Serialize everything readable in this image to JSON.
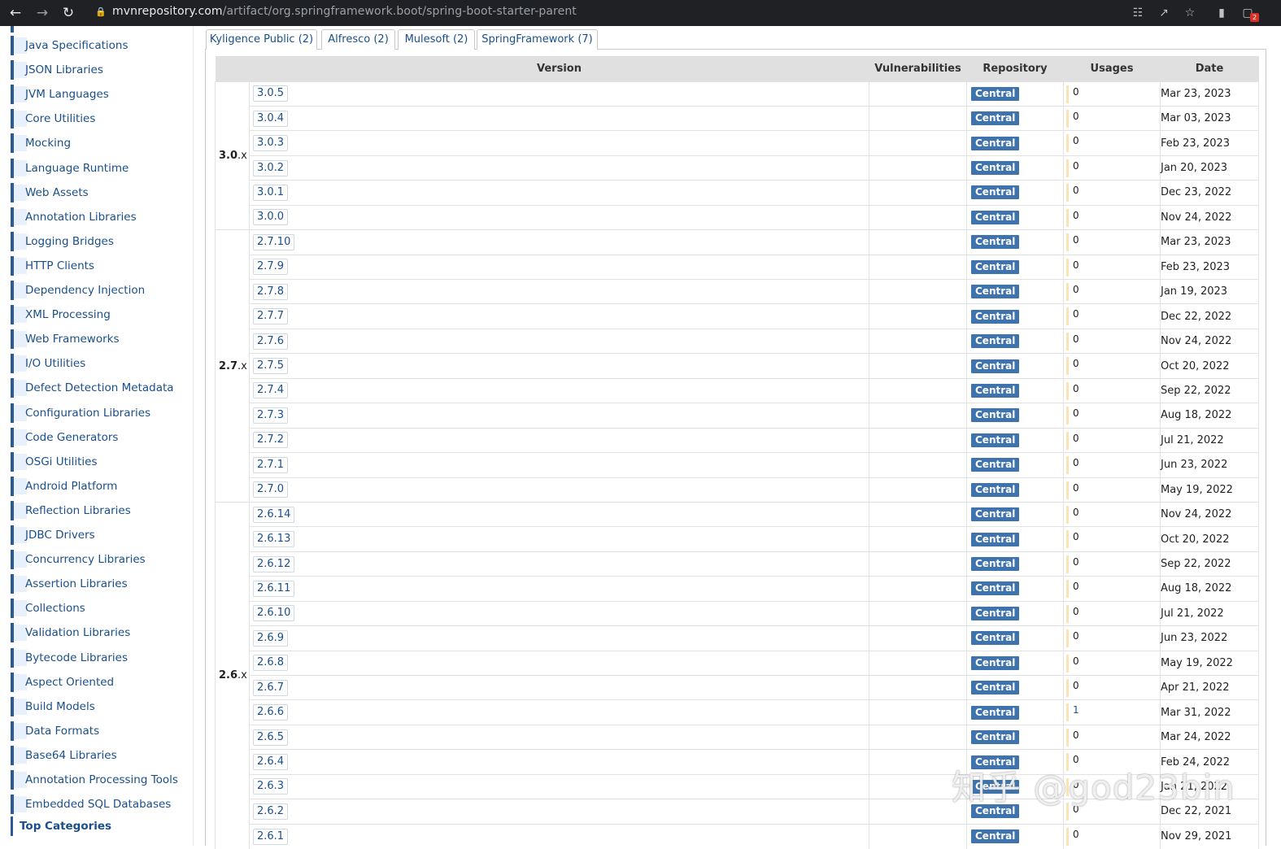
{
  "browser": {
    "url_host": "mvnrepository.com",
    "url_path": "/artifact/org.springframework.boot/spring-boot-starter-parent",
    "extension_badge": "2"
  },
  "sidebar": {
    "items": [
      "Java Specifications",
      "JSON Libraries",
      "JVM Languages",
      "Core Utilities",
      "Mocking",
      "Language Runtime",
      "Web Assets",
      "Annotation Libraries",
      "Logging Bridges",
      "HTTP Clients",
      "Dependency Injection",
      "XML Processing",
      "Web Frameworks",
      "I/O Utilities",
      "Defect Detection Metadata",
      "Configuration Libraries",
      "Code Generators",
      "OSGi Utilities",
      "Android Platform",
      "Reflection Libraries",
      "JDBC Drivers",
      "Concurrency Libraries",
      "Assertion Libraries",
      "Collections",
      "Validation Libraries",
      "Bytecode Libraries",
      "Aspect Oriented",
      "Build Models",
      "Data Formats",
      "Base64 Libraries",
      "Annotation Processing Tools",
      "Embedded SQL Databases"
    ],
    "top_categories_label": "Top Categories"
  },
  "tabs": [
    "Kyligence Public (2)",
    "Alfresco (2)",
    "Mulesoft (2)",
    "SpringFramework (7)"
  ],
  "table": {
    "headers": {
      "version": "Version",
      "vulnerabilities": "Vulnerabilities",
      "repository": "Repository",
      "usages": "Usages",
      "date": "Date"
    },
    "groups": [
      {
        "major": "3.0",
        "suffix": ".x",
        "rows": [
          {
            "v": "3.0.5",
            "repo": "Central",
            "usages": "0",
            "date": "Mar 23, 2023"
          },
          {
            "v": "3.0.4",
            "repo": "Central",
            "usages": "0",
            "date": "Mar 03, 2023"
          },
          {
            "v": "3.0.3",
            "repo": "Central",
            "usages": "0",
            "date": "Feb 23, 2023"
          },
          {
            "v": "3.0.2",
            "repo": "Central",
            "usages": "0",
            "date": "Jan 20, 2023"
          },
          {
            "v": "3.0.1",
            "repo": "Central",
            "usages": "0",
            "date": "Dec 23, 2022"
          },
          {
            "v": "3.0.0",
            "repo": "Central",
            "usages": "0",
            "date": "Nov 24, 2022"
          }
        ]
      },
      {
        "major": "2.7",
        "suffix": ".x",
        "rows": [
          {
            "v": "2.7.10",
            "repo": "Central",
            "usages": "0",
            "date": "Mar 23, 2023"
          },
          {
            "v": "2.7.9",
            "repo": "Central",
            "usages": "0",
            "date": "Feb 23, 2023"
          },
          {
            "v": "2.7.8",
            "repo": "Central",
            "usages": "0",
            "date": "Jan 19, 2023"
          },
          {
            "v": "2.7.7",
            "repo": "Central",
            "usages": "0",
            "date": "Dec 22, 2022"
          },
          {
            "v": "2.7.6",
            "repo": "Central",
            "usages": "0",
            "date": "Nov 24, 2022"
          },
          {
            "v": "2.7.5",
            "repo": "Central",
            "usages": "0",
            "date": "Oct 20, 2022"
          },
          {
            "v": "2.7.4",
            "repo": "Central",
            "usages": "0",
            "date": "Sep 22, 2022"
          },
          {
            "v": "2.7.3",
            "repo": "Central",
            "usages": "0",
            "date": "Aug 18, 2022"
          },
          {
            "v": "2.7.2",
            "repo": "Central",
            "usages": "0",
            "date": "Jul 21, 2022"
          },
          {
            "v": "2.7.1",
            "repo": "Central",
            "usages": "0",
            "date": "Jun 23, 2022"
          },
          {
            "v": "2.7.0",
            "repo": "Central",
            "usages": "0",
            "date": "May 19, 2022"
          }
        ]
      },
      {
        "major": "2.6",
        "suffix": ".x",
        "rows": [
          {
            "v": "2.6.14",
            "repo": "Central",
            "usages": "0",
            "date": "Nov 24, 2022"
          },
          {
            "v": "2.6.13",
            "repo": "Central",
            "usages": "0",
            "date": "Oct 20, 2022"
          },
          {
            "v": "2.6.12",
            "repo": "Central",
            "usages": "0",
            "date": "Sep 22, 2022"
          },
          {
            "v": "2.6.11",
            "repo": "Central",
            "usages": "0",
            "date": "Aug 18, 2022"
          },
          {
            "v": "2.6.10",
            "repo": "Central",
            "usages": "0",
            "date": "Jul 21, 2022"
          },
          {
            "v": "2.6.9",
            "repo": "Central",
            "usages": "0",
            "date": "Jun 23, 2022"
          },
          {
            "v": "2.6.8",
            "repo": "Central",
            "usages": "0",
            "date": "May 19, 2022"
          },
          {
            "v": "2.6.7",
            "repo": "Central",
            "usages": "0",
            "date": "Apr 21, 2022"
          },
          {
            "v": "2.6.6",
            "repo": "Central",
            "usages": "1",
            "date": "Mar 31, 2022"
          },
          {
            "v": "2.6.5",
            "repo": "Central",
            "usages": "0",
            "date": "Mar 24, 2022"
          },
          {
            "v": "2.6.4",
            "repo": "Central",
            "usages": "0",
            "date": "Feb 24, 2022"
          },
          {
            "v": "2.6.3",
            "repo": "Central",
            "usages": "0",
            "date": "Jan 21, 2022"
          },
          {
            "v": "2.6.2",
            "repo": "Central",
            "usages": "0",
            "date": "Dec 22, 2021"
          },
          {
            "v": "2.6.1",
            "repo": "Central",
            "usages": "0",
            "date": "Nov 29, 2021"
          }
        ]
      }
    ]
  },
  "watermark": "知乎 @god23bin",
  "colors": {
    "link": "#1a4f8b",
    "badge": "#3f73ad",
    "chrome": "#202124"
  }
}
